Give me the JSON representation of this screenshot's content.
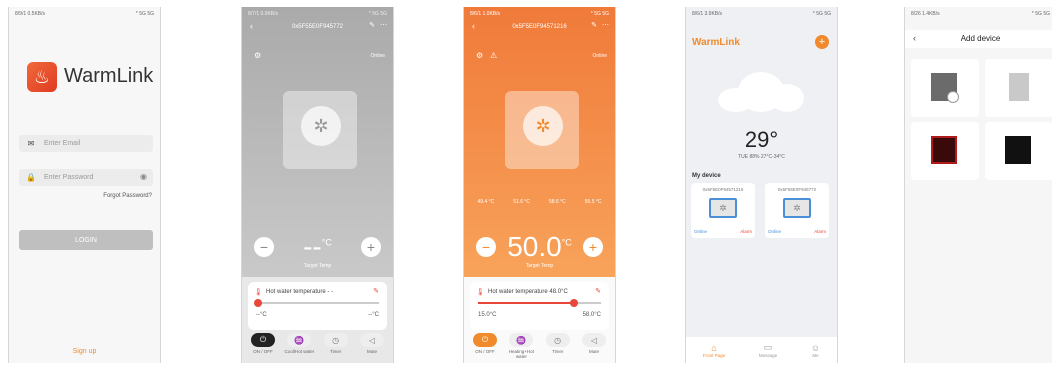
{
  "phone1": {
    "status": {
      "left": "8/9/1 0.5KB/s",
      "right": "* 5G 5G"
    },
    "logo_text": "WarmLink",
    "email_placeholder": "Enter Email",
    "password_placeholder": "Enter Password",
    "forgot": "Forgot Password?",
    "login": "LOGIN",
    "signup": "Sign up"
  },
  "phone2": {
    "status": {
      "left": "8/7/1 0.9KB/s",
      "right": "* 5G 5G"
    },
    "title": "0x5F55E0F945772",
    "online": "Online",
    "temp": "--",
    "unit": "°C",
    "target": "Target Temp",
    "card_title": "Hot water temperature",
    "card_value": "- -",
    "range_min": "--°C",
    "range_max": "--°C",
    "modes": [
      "ON / OFF",
      "Cool/Hot water",
      "Timer",
      "Mute"
    ]
  },
  "phone3": {
    "status": {
      "left": "8/6/1 1.0KB/s",
      "right": "* 5G 5G"
    },
    "title": "0x5F5E0F94571216",
    "online": "Online",
    "temp": "50.0",
    "unit": "°C",
    "target": "Target Temp",
    "readings": [
      "49.4 °C",
      "51.6 °C",
      "58.6 °C",
      "55.5 °C"
    ],
    "card_title": "Hot water temperature",
    "card_value": "48.0°C",
    "range_min": "15.0°C",
    "range_max": "58.0°C",
    "slider_level": 0.78,
    "modes": [
      "ON / OFF",
      "Heating+Hot water",
      "Timer",
      "Mute"
    ]
  },
  "phone4": {
    "status": {
      "left": "8/6/1 3.9KB/s",
      "right": "* 5G 5G"
    },
    "title": "WarmLink",
    "temp": "29°",
    "weather": "TUE 88% 27°C-34°C",
    "my_device": "My device",
    "devices": [
      {
        "name": "0x5F5E0F94571216",
        "online": "Online",
        "alarm": "Alarm"
      },
      {
        "name": "0x5F55E0F945772",
        "online": "Online",
        "alarm": "Alarm"
      }
    ],
    "tabs": [
      "Front Page",
      "Message",
      "Me"
    ]
  },
  "phone5": {
    "status": {
      "left": "8/26 1.4KB/s",
      "right": "* 5G 5G"
    },
    "title": "Add device"
  },
  "colors": {
    "accent": "#f08a2c",
    "alarm": "#e8473a",
    "online": "#4a8fd8"
  }
}
